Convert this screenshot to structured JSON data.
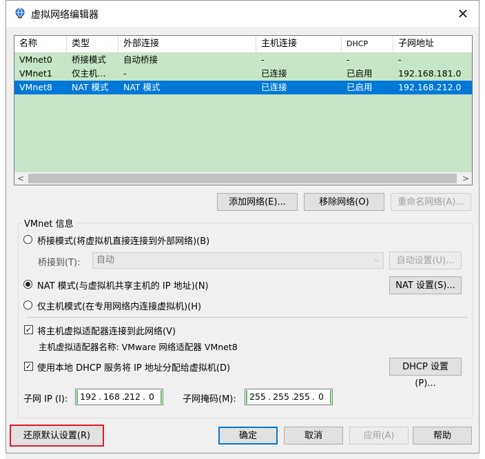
{
  "window": {
    "title": "虚拟网络编辑器",
    "close_glyph": "✕"
  },
  "network_list": {
    "headers": [
      "名称",
      "类型",
      "外部连接",
      "主机连接",
      "DHCP",
      "子网地址"
    ],
    "rows": [
      [
        "VMnet0",
        "桥接模式",
        "自动桥接",
        "-",
        "-",
        "-"
      ],
      [
        "VMnet1",
        "仅主机...",
        "-",
        "已连接",
        "已启用",
        "192.168.181.0"
      ],
      [
        "VMnet8",
        "NAT 模式",
        "NAT 模式",
        "已连接",
        "已启用",
        "192.168.212.0"
      ]
    ],
    "selected_index": 2,
    "scroll_left": "<",
    "scroll_right": ">"
  },
  "list_buttons": {
    "add": "添加网络(E)...",
    "remove": "移除网络(O)",
    "rename": "重命名网络(A)..."
  },
  "vmnet_info": {
    "group_title": "VMnet 信息",
    "bridged_label": "桥接模式(将虚拟机直接连接到外部网络)(B)",
    "bridged_to_label": "桥接到(T):",
    "bridged_to_value": "自动",
    "auto_settings": "自动设置(U)...",
    "nat_label": "NAT 模式(与虚拟机共享主机的 IP 地址)(N)",
    "nat_settings": "NAT 设置(S)...",
    "hostonly_label": "仅主机模式(在专用网络内连接虚拟机)(H)",
    "selected_mode": "nat",
    "connect_adapter_label": "将主机虚拟适配器连接到此网络(V)",
    "connect_adapter_checked": true,
    "adapter_name_label": "主机虚拟适配器名称: VMware 网络适配器 VMnet8",
    "dhcp_label": "使用本地 DHCP 服务将 IP 地址分配给虚拟机(D)",
    "dhcp_checked": true,
    "dhcp_settings": "DHCP 设置(P)...",
    "subnet_ip_label": "子网 IP (I):",
    "subnet_ip": [
      "192",
      "168",
      "212",
      "0"
    ],
    "subnet_mask_label": "子网掩码(M):",
    "subnet_mask": [
      "255",
      "255",
      "255",
      "0"
    ]
  },
  "footer": {
    "restore": "还原默认设置(R)",
    "ok": "确定",
    "cancel": "取消",
    "apply": "应用(A)",
    "help": "帮助"
  },
  "colors": {
    "list_bg": "#c7e6c7",
    "selection": "#0078d7",
    "highlight_outline": "#e0162b"
  }
}
